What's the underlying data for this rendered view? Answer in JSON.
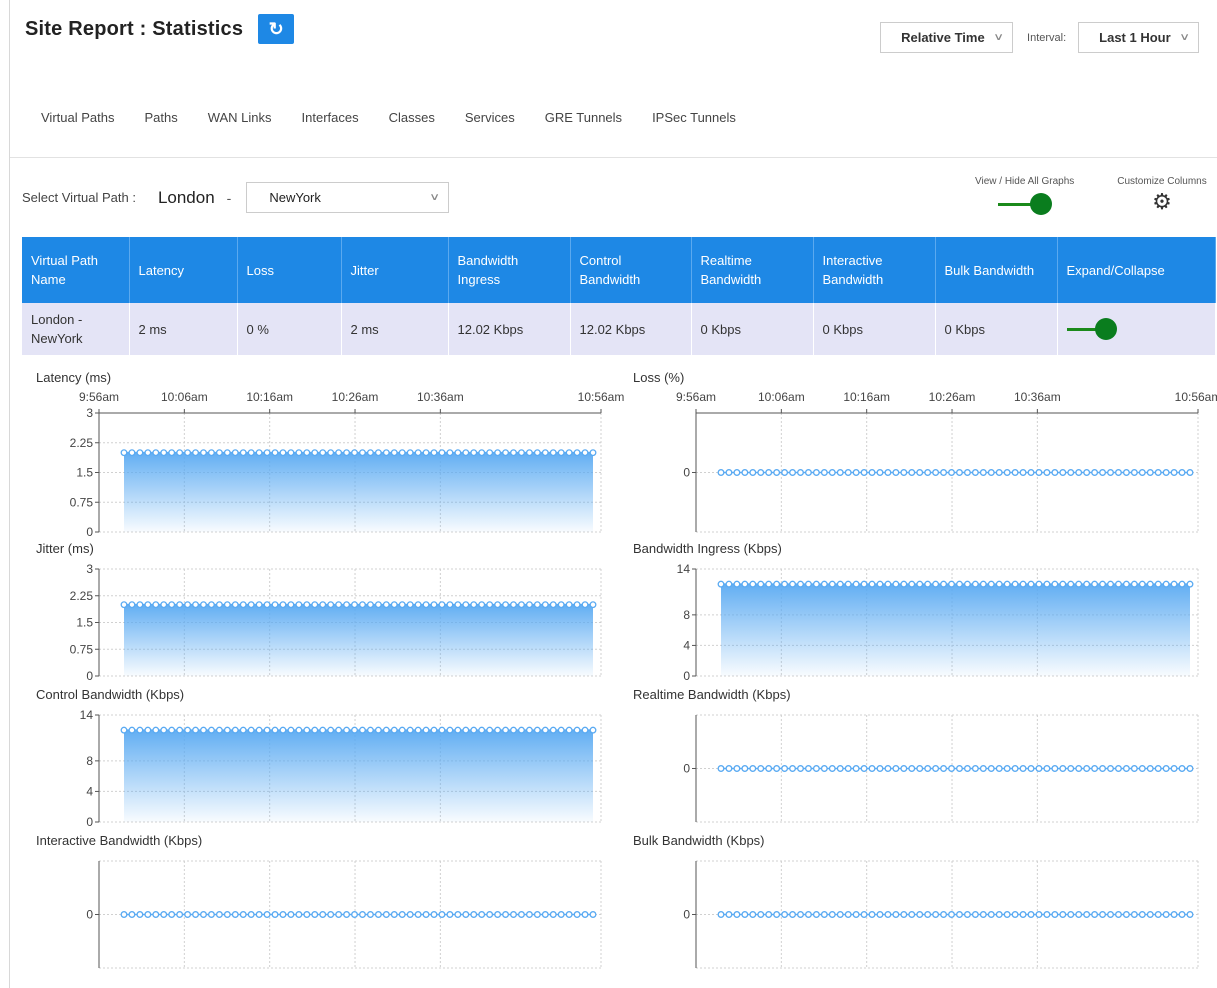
{
  "header": {
    "title": "Site Report : Statistics",
    "refresh_icon": "refresh-icon"
  },
  "controls": {
    "time_mode": "Relative Time",
    "interval_label": "Interval:",
    "interval_value": "Last 1 Hour"
  },
  "tabs": [
    {
      "label": "Virtual Paths",
      "active": true
    },
    {
      "label": "Paths",
      "active": false
    },
    {
      "label": "WAN Links",
      "active": false
    },
    {
      "label": "Interfaces",
      "active": false
    },
    {
      "label": "Classes",
      "active": false
    },
    {
      "label": "Services",
      "active": false
    },
    {
      "label": "GRE Tunnels",
      "active": false
    },
    {
      "label": "IPSec Tunnels",
      "active": false
    }
  ],
  "virtual_path": {
    "label": "Select Virtual Path :",
    "site": "London",
    "separator": "-",
    "selected": "NewYork"
  },
  "graph_toggle": {
    "label": "View / Hide All Graphs",
    "on": true
  },
  "customize": {
    "label": "Customize Columns",
    "icon": "gear-icon"
  },
  "table": {
    "headers": [
      "Virtual Path Name",
      "Latency",
      "Loss",
      "Jitter",
      "Bandwidth Ingress",
      "Control Bandwidth",
      "Realtime Bandwidth",
      "Interactive Bandwidth",
      "Bulk Bandwidth",
      "Expand/Collapse"
    ],
    "rows": [
      [
        "London - NewYork",
        "2 ms",
        "0 %",
        "2 ms",
        "12.02 Kbps",
        "12.02 Kbps",
        "0 Kbps",
        "0 Kbps",
        "0 Kbps"
      ]
    ],
    "expanded": true
  },
  "colors": {
    "accent": "#1e88e5",
    "toggle": "#0a7d1e",
    "row_bg": "#e4e4f6",
    "series": "#5aaaf2"
  },
  "chart_data": [
    {
      "type": "area",
      "title": "Latency (ms)",
      "xticks": [
        "9:56am",
        "10:06am",
        "10:16am",
        "10:26am",
        "10:36am",
        "10:56am"
      ],
      "yticks": [
        "3",
        "2.25",
        "1.5",
        "0.75",
        "0"
      ],
      "ylim": [
        0,
        3
      ],
      "value": 2,
      "points": 60
    },
    {
      "type": "line",
      "title": "Loss (%)",
      "xticks": [
        "9:56am",
        "10:06am",
        "10:16am",
        "10:26am",
        "10:36am",
        "10:56am"
      ],
      "yticks": [
        "0"
      ],
      "ylim": [
        -1,
        1
      ],
      "value": 0,
      "points": 60
    },
    {
      "type": "area",
      "title": "Jitter (ms)",
      "xticks": [],
      "yticks": [
        "3",
        "2.25",
        "1.5",
        "0.75",
        "0"
      ],
      "ylim": [
        0,
        3
      ],
      "value": 2,
      "points": 60
    },
    {
      "type": "area",
      "title": "Bandwidth Ingress (Kbps)",
      "xticks": [],
      "yticks": [
        "14",
        "8",
        "4",
        "0"
      ],
      "ylim": [
        0,
        14
      ],
      "value": 12.02,
      "points": 60
    },
    {
      "type": "area",
      "title": "Control Bandwidth (Kbps)",
      "xticks": [],
      "yticks": [
        "14",
        "8",
        "4",
        "0"
      ],
      "ylim": [
        0,
        14
      ],
      "value": 12.02,
      "points": 60
    },
    {
      "type": "line",
      "title": "Realtime Bandwidth (Kbps)",
      "xticks": [],
      "yticks": [
        "0"
      ],
      "ylim": [
        -1,
        1
      ],
      "value": 0,
      "points": 60
    },
    {
      "type": "line",
      "title": "Interactive Bandwidth (Kbps)",
      "xticks": [],
      "yticks": [
        "0"
      ],
      "ylim": [
        -1,
        1
      ],
      "value": 0,
      "points": 60
    },
    {
      "type": "line",
      "title": "Bulk Bandwidth (Kbps)",
      "xticks": [],
      "yticks": [
        "0"
      ],
      "ylim": [
        -1,
        1
      ],
      "value": 0,
      "points": 60
    }
  ]
}
